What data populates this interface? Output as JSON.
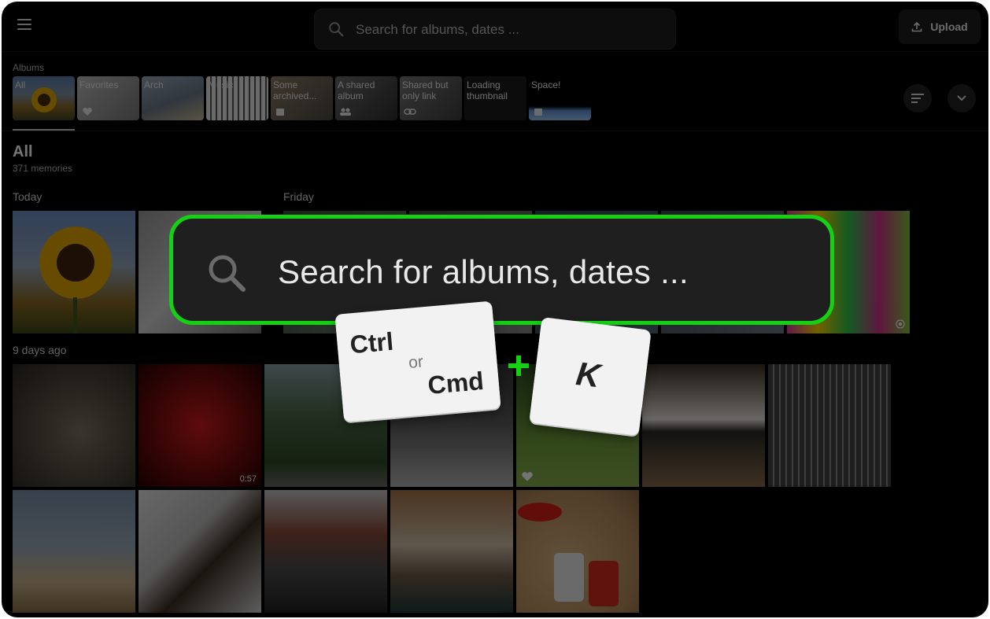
{
  "header": {
    "search_placeholder": "Search for albums, dates ...",
    "upload_label": "Upload"
  },
  "albums": {
    "section_label": "Albums",
    "items": [
      {
        "label": "All"
      },
      {
        "label": "Favorites"
      },
      {
        "label": "Arch"
      },
      {
        "label": "Music"
      },
      {
        "label": "Some archived..."
      },
      {
        "label": "A shared album"
      },
      {
        "label": "Shared but only link"
      },
      {
        "label": "Loading thumbnail"
      },
      {
        "label": "Space!"
      }
    ]
  },
  "gallery": {
    "title": "All",
    "count": "371 memories",
    "groups": [
      {
        "label": "Today"
      },
      {
        "label": "Friday"
      },
      {
        "label": "9 days ago"
      }
    ],
    "video_duration": "0:57"
  },
  "overlay": {
    "search_text": "Search for albums, dates ...",
    "key1_top": "Ctrl",
    "key1_mid": "or",
    "key1_bottom": "Cmd",
    "key2": "K",
    "accent_color": "#14d114"
  }
}
